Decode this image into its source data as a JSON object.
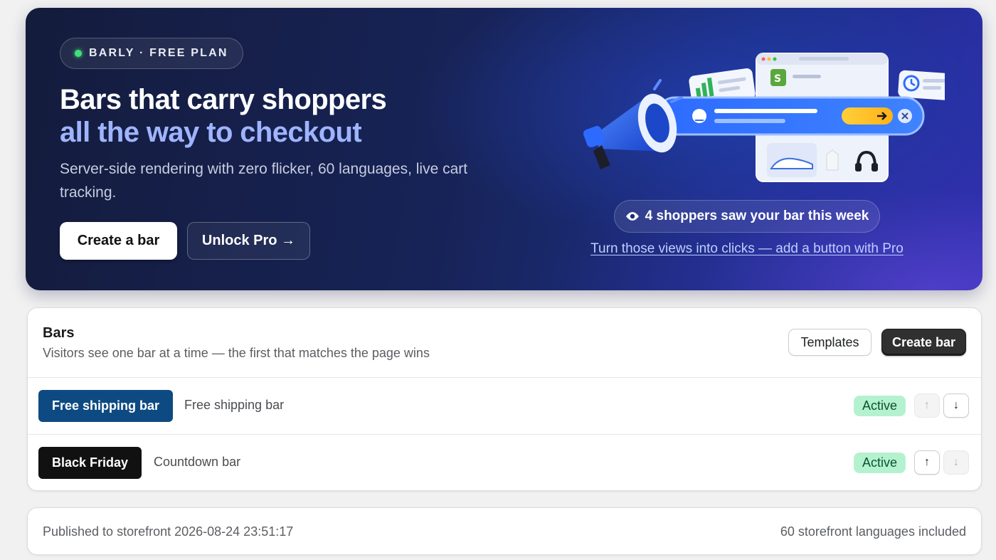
{
  "hero": {
    "plan_badge": "BARLY · FREE PLAN",
    "title_line1": "Bars that carry shoppers",
    "title_line2": "all the way to checkout",
    "subtitle": "Server-side rendering with zero flicker, 60 languages, live cart tracking.",
    "create_button": "Create a bar",
    "pro_button": "Unlock Pro →",
    "views_pill": "4 shoppers saw your bar this week",
    "upsell_link": "Turn those views into clicks — add a button with Pro",
    "colors": {
      "accent": "#9fb4ff",
      "status_dot": "#3ee07a"
    }
  },
  "bars_section": {
    "title": "Bars",
    "description": "Visitors see one bar at a time — the first that matches the page wins",
    "templates_button": "Templates",
    "create_button": "Create bar",
    "items": [
      {
        "name": "Free shipping bar",
        "type": "Free shipping bar",
        "status": "Active",
        "chip_color": "#0e4a82",
        "move_up_enabled": false,
        "move_down_enabled": true
      },
      {
        "name": "Black Friday",
        "type": "Countdown bar",
        "status": "Active",
        "chip_color": "#111111",
        "move_up_enabled": true,
        "move_down_enabled": false
      }
    ]
  },
  "footer": {
    "published": "Published to storefront 2026-08-24 23:51:17",
    "languages": "60 storefront languages included"
  },
  "icons": {
    "up": "↑",
    "down": "↓",
    "eye": "eye-icon"
  }
}
